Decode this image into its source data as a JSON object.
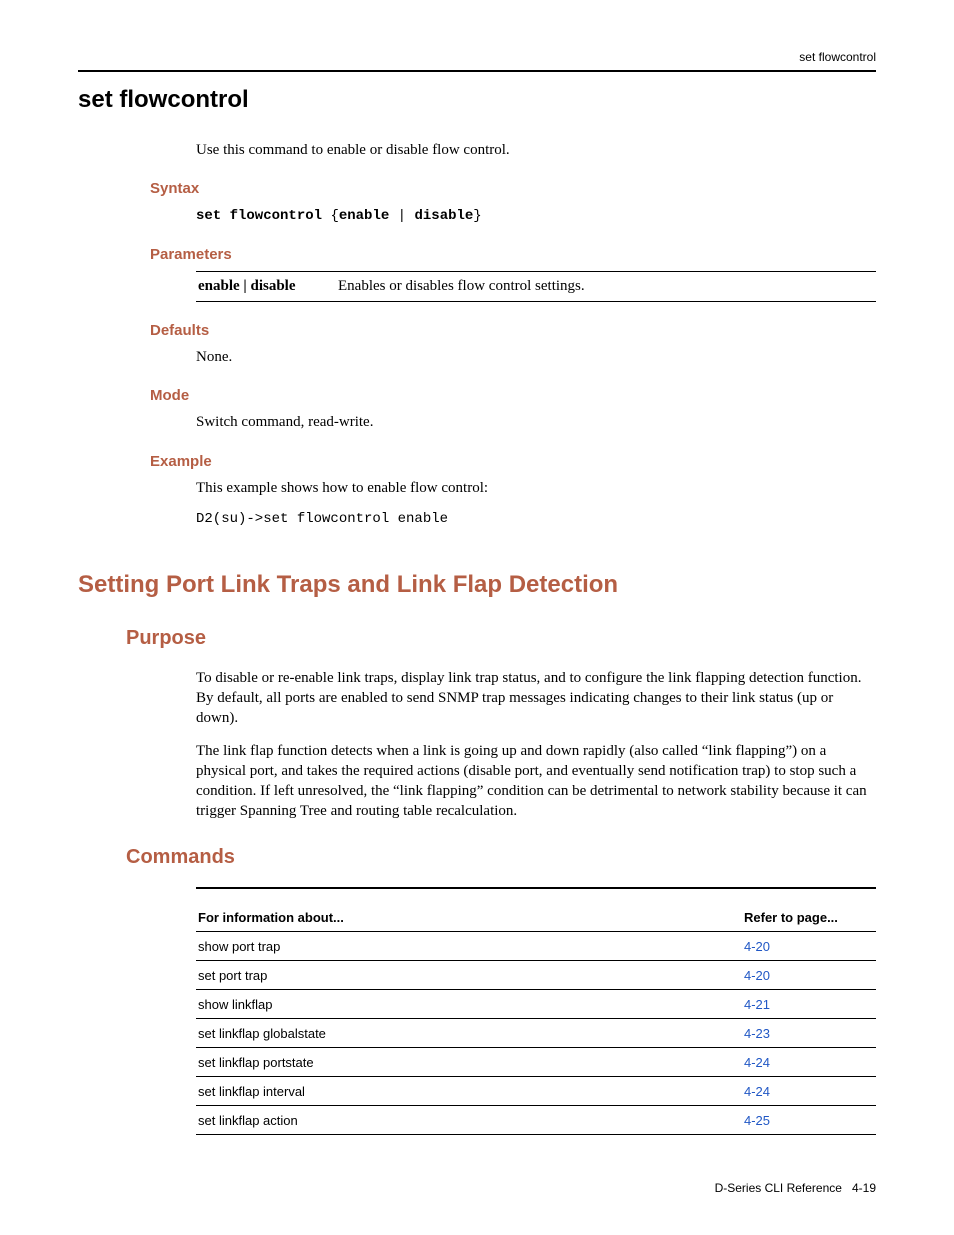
{
  "header": {
    "running_title": "set flowcontrol"
  },
  "cmd": {
    "title": "set flowcontrol",
    "intro": "Use this command to enable or disable flow control.",
    "syntax_heading": "Syntax",
    "syntax_pre": "set flowcontrol",
    "syntax_brace_open": "{",
    "syntax_opt1": "enable",
    "syntax_pipe": " | ",
    "syntax_opt2": "disable",
    "syntax_brace_close": "}",
    "params_heading": "Parameters",
    "param_key": "enable | disable",
    "param_val": "Enables or disables flow control settings.",
    "defaults_heading": "Defaults",
    "defaults_val": "None.",
    "mode_heading": "Mode",
    "mode_val": "Switch command, read-write.",
    "example_heading": "Example",
    "example_intro": "This example shows how to enable flow control:",
    "example_code": "D2(su)->set flowcontrol enable"
  },
  "section": {
    "title": "Setting Port Link Traps and Link Flap Detection",
    "purpose_heading": "Purpose",
    "purpose_p1": "To disable or re-enable link traps, display link trap status, and to configure the link flapping detection function. By default, all ports are enabled to send SNMP trap messages indicating changes to their link status (up or down).",
    "purpose_p2": "The link flap function detects when a link is going up and down rapidly (also called “link flapping”) on a physical port, and takes the required actions (disable port, and eventually send notification trap) to stop such a condition. If left unresolved, the “link flapping” condition can be detrimental to network stability because it can trigger Spanning Tree and routing table recalculation.",
    "commands_heading": "Commands",
    "table": {
      "col1": "For information about...",
      "col2": "Refer to page...",
      "rows": [
        {
          "name": "show port trap",
          "page": "4-20"
        },
        {
          "name": "set port trap",
          "page": "4-20"
        },
        {
          "name": "show linkflap",
          "page": "4-21"
        },
        {
          "name": "set linkflap globalstate",
          "page": "4-23"
        },
        {
          "name": "set linkflap portstate",
          "page": "4-24"
        },
        {
          "name": "set linkflap interval",
          "page": "4-24"
        },
        {
          "name": "set linkflap action",
          "page": "4-25"
        }
      ]
    }
  },
  "footer": {
    "book": "D-Series CLI Reference",
    "page": "4-19"
  }
}
